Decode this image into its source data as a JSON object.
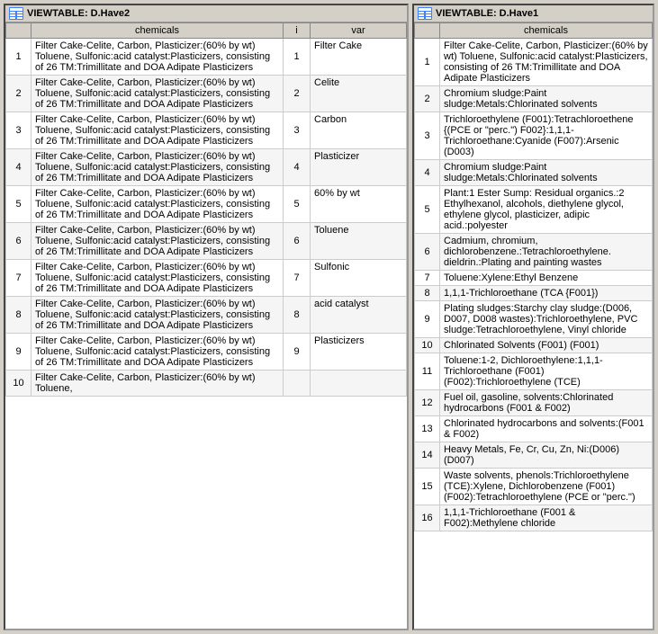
{
  "left_table": {
    "title": "VIEWTABLE: D.Have2",
    "columns": [
      "chemicals",
      "i",
      "var"
    ],
    "rows": [
      {
        "num": 1,
        "chemicals": "Filter Cake-Celite, Carbon, Plasticizer:(60% by wt) Toluene, Sulfonic:acid catalyst:Plasticizers, consisting of 26 TM:Trimillitate and DOA Adipate Plasticizers",
        "i": 1,
        "var": "Filter Cake"
      },
      {
        "num": 2,
        "chemicals": "Filter Cake-Celite, Carbon, Plasticizer:(60% by wt) Toluene, Sulfonic:acid catalyst:Plasticizers, consisting of 26 TM:Trimillitate and DOA Adipate Plasticizers",
        "i": 2,
        "var": "Celite"
      },
      {
        "num": 3,
        "chemicals": "Filter Cake-Celite, Carbon, Plasticizer:(60% by wt) Toluene, Sulfonic:acid catalyst:Plasticizers, consisting of 26 TM:Trimillitate and DOA Adipate Plasticizers",
        "i": 3,
        "var": "Carbon"
      },
      {
        "num": 4,
        "chemicals": "Filter Cake-Celite, Carbon, Plasticizer:(60% by wt) Toluene, Sulfonic:acid catalyst:Plasticizers, consisting of 26 TM:Trimillitate and DOA Adipate Plasticizers",
        "i": 4,
        "var": "Plasticizer"
      },
      {
        "num": 5,
        "chemicals": "Filter Cake-Celite, Carbon, Plasticizer:(60% by wt) Toluene, Sulfonic:acid catalyst:Plasticizers, consisting of 26 TM:Trimillitate and DOA Adipate Plasticizers",
        "i": 5,
        "var": "60% by wt"
      },
      {
        "num": 6,
        "chemicals": "Filter Cake-Celite, Carbon, Plasticizer:(60% by wt) Toluene, Sulfonic:acid catalyst:Plasticizers, consisting of 26 TM:Trimillitate and DOA Adipate Plasticizers",
        "i": 6,
        "var": "Toluene"
      },
      {
        "num": 7,
        "chemicals": "Filter Cake-Celite, Carbon, Plasticizer:(60% by wt) Toluene, Sulfonic:acid catalyst:Plasticizers, consisting of 26 TM:Trimillitate and DOA Adipate Plasticizers",
        "i": 7,
        "var": "Sulfonic"
      },
      {
        "num": 8,
        "chemicals": "Filter Cake-Celite, Carbon, Plasticizer:(60% by wt) Toluene, Sulfonic:acid catalyst:Plasticizers, consisting of 26 TM:Trimillitate and DOA Adipate Plasticizers",
        "i": 8,
        "var": "acid catalyst"
      },
      {
        "num": 9,
        "chemicals": "Filter Cake-Celite, Carbon, Plasticizer:(60% by wt) Toluene, Sulfonic:acid catalyst:Plasticizers, consisting of 26 TM:Trimillitate and DOA Adipate Plasticizers",
        "i": 9,
        "var": "Plasticizers"
      },
      {
        "num": 10,
        "chemicals": "Filter Cake-Celite, Carbon, Plasticizer:(60% by wt) Toluene,",
        "i": "",
        "var": ""
      }
    ]
  },
  "right_table": {
    "title": "VIEWTABLE: D.Have1",
    "columns": [
      "chemicals"
    ],
    "rows": [
      {
        "num": 1,
        "chemicals": "Filter Cake-Celite, Carbon, Plasticizer:(60% by wt) Toluene, Sulfonic:acid catalyst:Plasticizers, consisting of 26 TM:Trimillitate and DOA Adipate Plasticizers"
      },
      {
        "num": 2,
        "chemicals": "Chromium sludge:Paint sludge:Metals:Chlorinated solvents"
      },
      {
        "num": 3,
        "chemicals": "Trichloroethylene (F001):Tetrachloroethene {(PCE or \"perc.\") F002}:1,1,1-Trichloroethane:Cyanide (F007):Arsenic  (D003)"
      },
      {
        "num": 4,
        "chemicals": "Chromium sludge:Paint sludge:Metals:Chlorinated solvents"
      },
      {
        "num": 5,
        "chemicals": "Plant:1 Ester Sump: Residual organics.:2 Ethylhexanol, alcohols, diethylene glycol, ethylene glycol, plasticizer, adipic acid.:polyester"
      },
      {
        "num": 6,
        "chemicals": "Cadmium, chromium, dichlorobenzene.:Tetrachloroethylene. dieldrin.:Plating and painting wastes"
      },
      {
        "num": 7,
        "chemicals": "Toluene:Xylene:Ethyl Benzene"
      },
      {
        "num": 8,
        "chemicals": "1,1,1-Trichloroethane (TCA {F001})"
      },
      {
        "num": 9,
        "chemicals": "Plating sludges:Starchy clay sludge:(D006, D007, D008 wastes):Trichloroethylene, PVC sludge:Tetrachloroethylene, Vinyl chloride"
      },
      {
        "num": 10,
        "chemicals": "Chlorinated Solvents (F001) (F001)"
      },
      {
        "num": 11,
        "chemicals": "Toluene:1-2, Dichloroethylene:1,1,1-Trichloroethane (F001) (F002):Trichloroethylene (TCE)"
      },
      {
        "num": 12,
        "chemicals": "Fuel oil, gasoline, solvents:Chlorinated hydrocarbons (F001 & F002)"
      },
      {
        "num": 13,
        "chemicals": "Chlorinated hydrocarbons and solvents:(F001 & F002)"
      },
      {
        "num": 14,
        "chemicals": "Heavy Metals, Fe, Cr, Cu, Zn, Ni:(D006) (D007)"
      },
      {
        "num": 15,
        "chemicals": "Waste solvents, phenols:Trichloroethylene (TCE):Xylene, Dichlorobenzene (F001) (F002):Tetrachloroethylene (PCE or \"perc.\")"
      },
      {
        "num": 16,
        "chemicals": "1,1,1-Trichloroethane (F001 & F002):Methylene chloride"
      }
    ]
  }
}
